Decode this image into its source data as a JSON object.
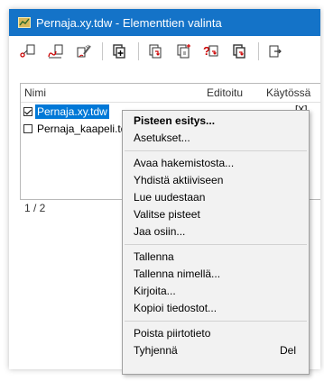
{
  "window": {
    "title": "Pernaja.xy.tdw - Elementtien valinta"
  },
  "toolbar": {
    "buttons": [
      "new-point-icon",
      "new-line-icon",
      "edit-brush-icon",
      "add-document-icon",
      "document-down-icon",
      "document-split-icon",
      "document-question-icon",
      "document-filter-icon",
      "document-export-icon"
    ]
  },
  "list": {
    "columns": {
      "name": "Nimi",
      "edited": "Editoitu",
      "in_use": "Käytössä"
    },
    "rows": [
      {
        "name": "Pernaja.xy.tdw",
        "checked": true,
        "selected": true,
        "in_use": "[X]"
      },
      {
        "name": "Pernaja_kaapeli.tdw",
        "checked": false,
        "selected": false,
        "in_use": ""
      }
    ]
  },
  "status": {
    "position": "1 / 2"
  },
  "context_menu": {
    "items": [
      {
        "label": "Pisteen esitys...",
        "bold": true
      },
      {
        "label": "Asetukset..."
      },
      {
        "label": "Avaa hakemistosta..."
      },
      {
        "label": "Yhdistä aktiiviseen"
      },
      {
        "label": "Lue uudestaan"
      },
      {
        "label": "Valitse pisteet"
      },
      {
        "label": "Jaa osiin..."
      },
      {
        "label": "Tallenna"
      },
      {
        "label": "Tallenna nimellä..."
      },
      {
        "label": "Kirjoita..."
      },
      {
        "label": "Kopioi tiedostot..."
      },
      {
        "label": "Poista piirtotieto"
      },
      {
        "label": "Tyhjennä",
        "shortcut": "Del"
      }
    ]
  },
  "colors": {
    "titlebar": "#1473c8",
    "selection": "#0078d7",
    "menu_bg": "#f2f2f2"
  }
}
